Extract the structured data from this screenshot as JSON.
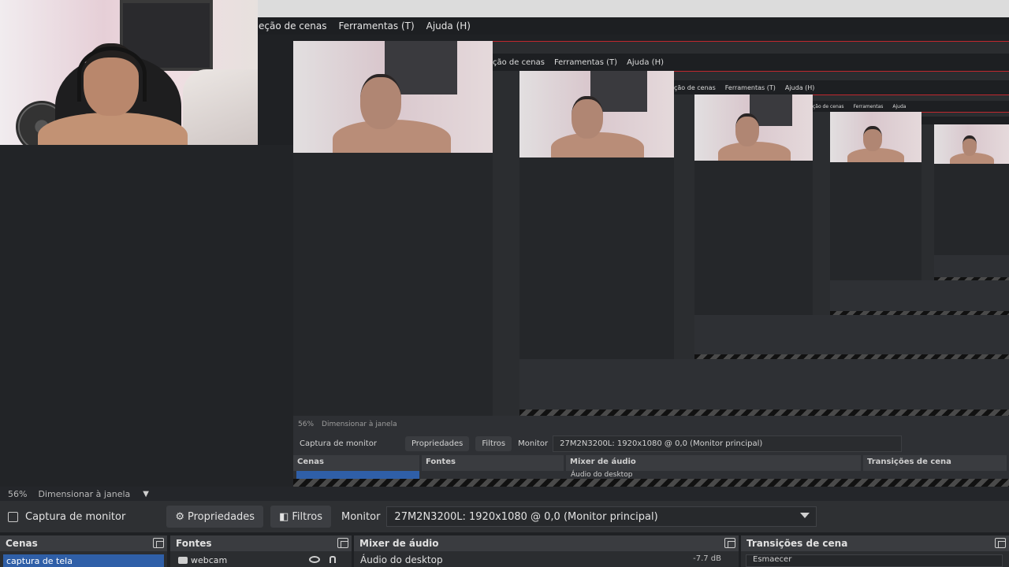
{
  "menu": {
    "items": [
      "eção de cenas",
      "Ferramentas (T)",
      "Ajuda (H)"
    ]
  },
  "preview": {
    "zoom": "56%",
    "scale_mode": "Dimensionar à janela",
    "source_label": "Captura de monitor",
    "properties_label": "Propriedades",
    "filters_label": "Filtros",
    "monitor_label": "Monitor",
    "monitor_value": "27M2N3200L: 1920x1080 @ 0,0 (Monitor principal)"
  },
  "docks": {
    "scenes": {
      "title": "Cenas",
      "items": [
        "captura de tela"
      ]
    },
    "sources": {
      "title": "Fontes",
      "items": [
        "webcam"
      ]
    },
    "mixer": {
      "title": "Mixer de áudio",
      "channel": "Áudio do desktop",
      "level": "-7.7 dB"
    },
    "transitions": {
      "title": "Transições de cena",
      "value": "Esmaecer"
    }
  },
  "colors": {
    "accent": "#2f5fa8",
    "selection_border": "#c0282e",
    "background": "#1f2124"
  }
}
